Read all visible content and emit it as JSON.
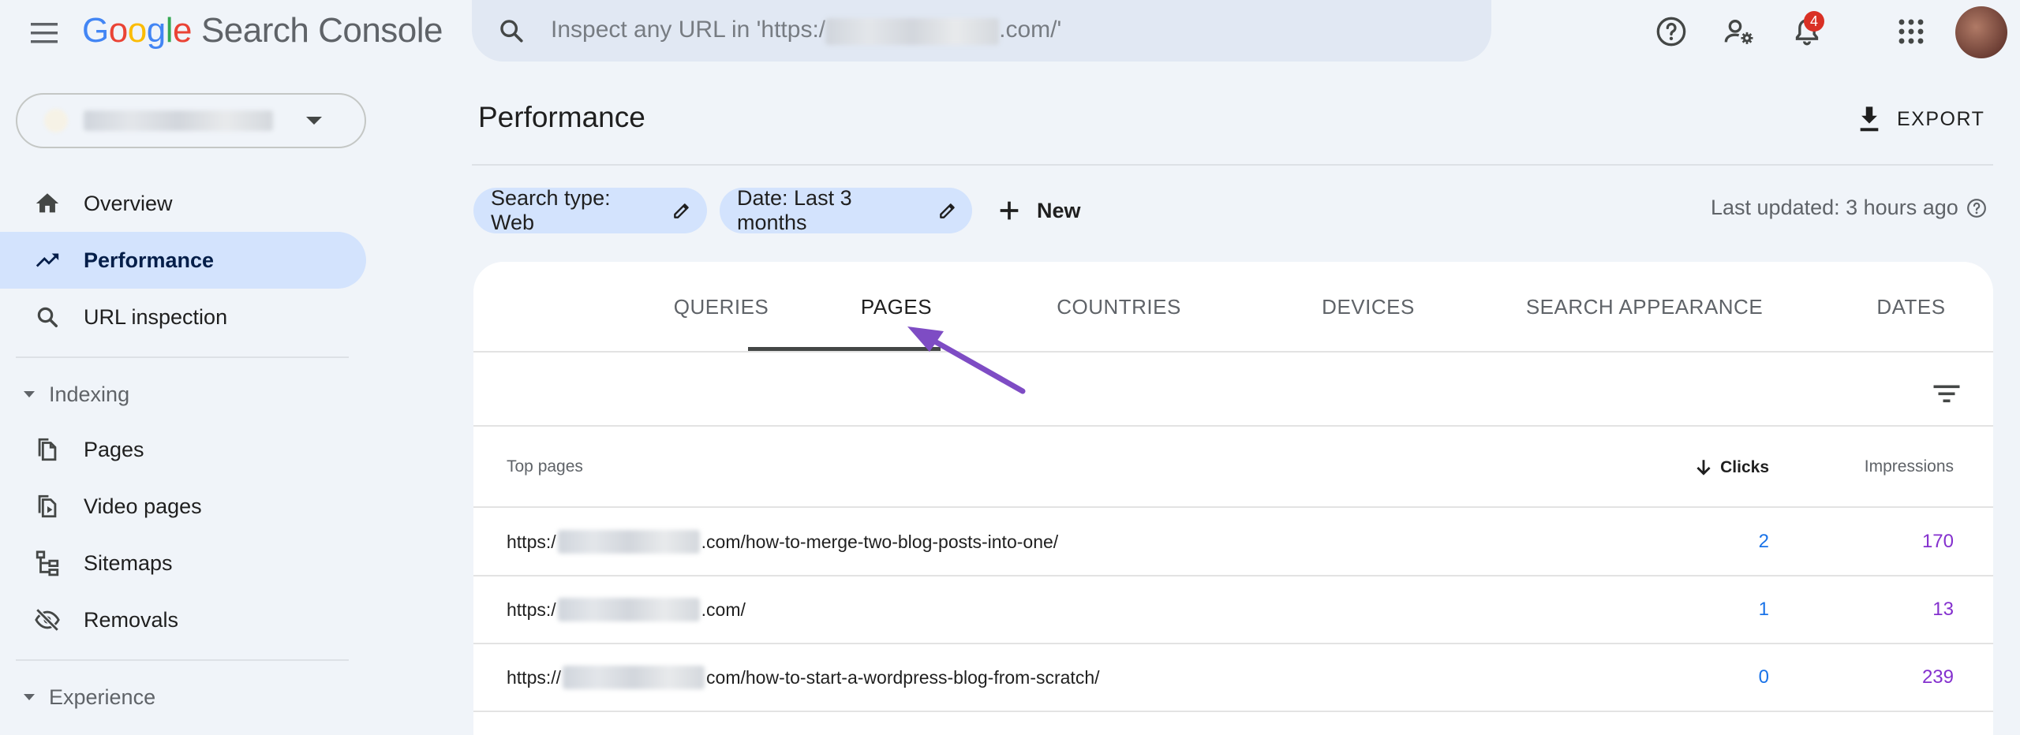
{
  "header": {
    "logo_letters": [
      "G",
      "o",
      "o",
      "g",
      "l",
      "e"
    ],
    "product": "Search Console",
    "search_placeholder_prefix": "Inspect any URL in 'https:/",
    "search_placeholder_suffix": ".com/'",
    "notifications_count": "4",
    "icons": [
      "menu-icon",
      "search-icon",
      "help-icon",
      "manage-users-icon",
      "notifications-icon",
      "apps-icon",
      "avatar"
    ]
  },
  "sidebar": {
    "items": [
      {
        "label": "Overview",
        "icon": "home-icon"
      },
      {
        "label": "Performance",
        "icon": "trending-up-icon",
        "active": true
      },
      {
        "label": "URL inspection",
        "icon": "search-icon"
      }
    ],
    "indexing": {
      "label": "Indexing",
      "items": [
        {
          "label": "Pages",
          "icon": "pages-icon"
        },
        {
          "label": "Video pages",
          "icon": "video-pages-icon"
        },
        {
          "label": "Sitemaps",
          "icon": "sitemap-icon"
        },
        {
          "label": "Removals",
          "icon": "removals-icon"
        }
      ]
    },
    "experience": {
      "label": "Experience"
    }
  },
  "main": {
    "title": "Performance",
    "export_label": "EXPORT",
    "chips": [
      {
        "label": "Search type: Web"
      },
      {
        "label": "Date: Last 3 months"
      }
    ],
    "new_label": "New",
    "last_updated": "Last updated: 3 hours ago",
    "tabs": [
      {
        "label": "QUERIES"
      },
      {
        "label": "PAGES",
        "active": true
      },
      {
        "label": "COUNTRIES"
      },
      {
        "label": "DEVICES"
      },
      {
        "label": "SEARCH APPEARANCE"
      },
      {
        "label": "DATES"
      }
    ],
    "table": {
      "col_pages": "Top pages",
      "col_clicks": "Clicks",
      "col_impressions": "Impressions",
      "sort_column": "Clicks",
      "sort_direction": "descending",
      "rows": [
        {
          "url_prefix": "https:/",
          "url_suffix": ".com/how-to-merge-two-blog-posts-into-one/",
          "clicks": "2",
          "impressions": "170"
        },
        {
          "url_prefix": "https:/",
          "url_suffix": ".com/",
          "clicks": "1",
          "impressions": "13"
        },
        {
          "url_prefix": "https://",
          "url_suffix": "com/how-to-start-a-wordpress-blog-from-scratch/",
          "clicks": "0",
          "impressions": "239"
        }
      ]
    }
  },
  "annotation": {
    "type": "arrow",
    "color": "#7e4cc4",
    "points_to": "PAGES tab"
  },
  "colors": {
    "page_bg": "#f0f4f9",
    "active_nav_bg": "#d3e3fd",
    "chip_bg": "#d3e3fd",
    "clicks_color": "#1a73e8",
    "impressions_color": "#8430ce",
    "badge": "#d93025"
  }
}
